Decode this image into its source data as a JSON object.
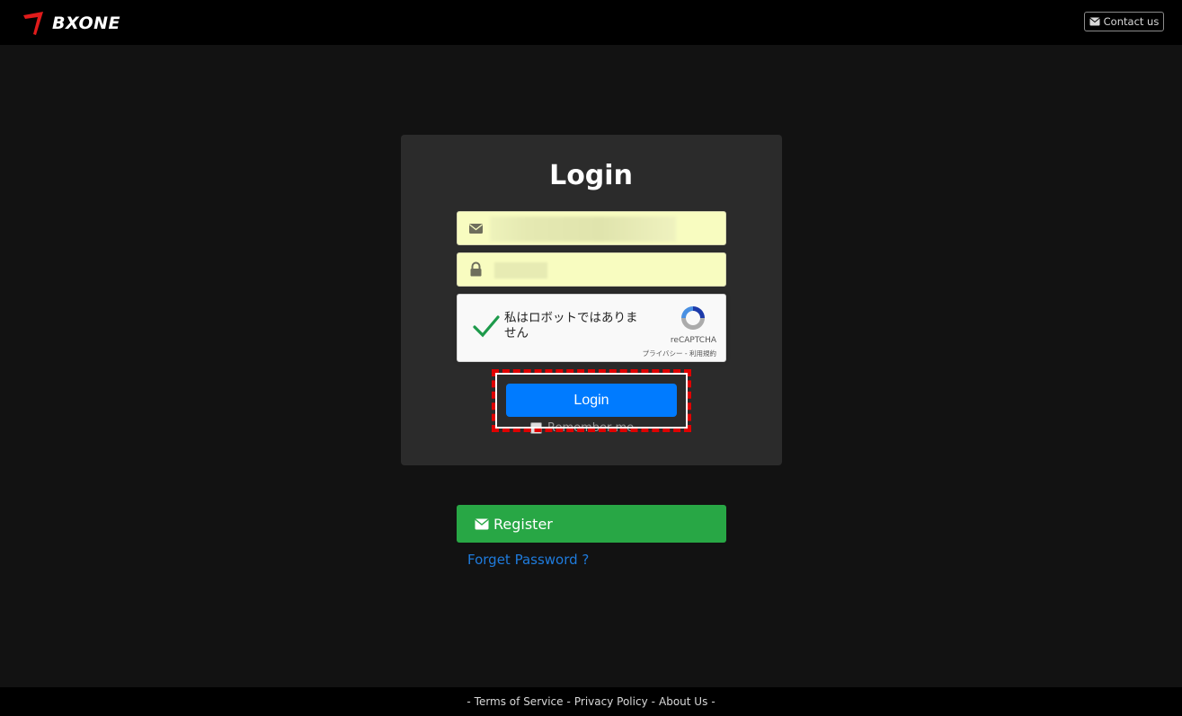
{
  "brand": {
    "name": "BXONE",
    "accent": "#e01b1b"
  },
  "header": {
    "contact_label": "Contact us",
    "contact_icon": "envelope-icon"
  },
  "login": {
    "title": "Login",
    "email_icon": "envelope-icon",
    "email_placeholder": "",
    "password_icon": "lock-icon",
    "password_placeholder": "",
    "submit_label": "Login",
    "remember_label": "Remember me",
    "submit_color": "#007bff"
  },
  "recaptcha": {
    "label": "私はロボットではありません",
    "brand": "reCAPTCHA",
    "links": "プライバシー - 利用規約",
    "checked": true
  },
  "register": {
    "label": "Register",
    "icon": "envelope-icon",
    "color": "#28a745"
  },
  "forgot_password": "Forget Password ?",
  "footer": {
    "prefix": "-",
    "links": [
      "Terms of Service",
      "Privacy Policy",
      "About Us"
    ],
    "separator": "-",
    "suffix": "-"
  }
}
